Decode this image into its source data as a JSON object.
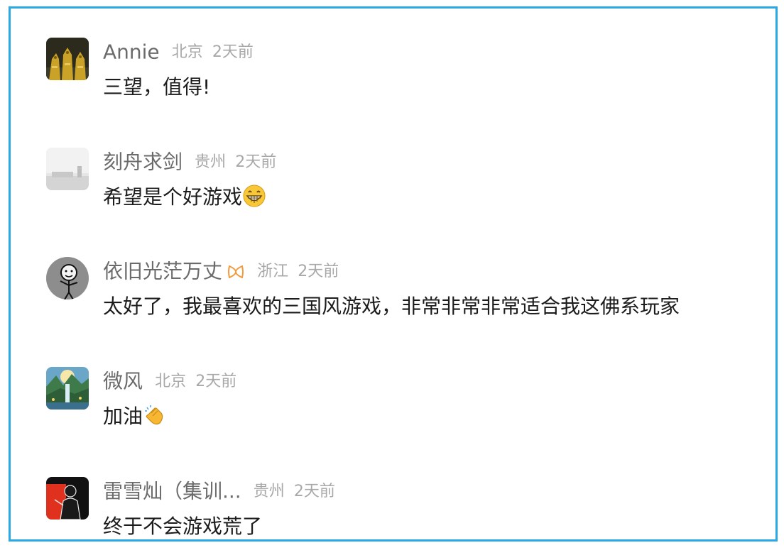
{
  "comments": [
    {
      "name": "Annie",
      "location": "北京",
      "time": "2天前",
      "text": "三望，值得!",
      "avatar": "golden-dragons-avatar"
    },
    {
      "name": "刻舟求剑",
      "location": "贵州",
      "time": "2天前",
      "text": "希望是个好游戏",
      "avatar": "gray-room-avatar",
      "emoji": "grinning-face-emoji"
    },
    {
      "name": "依旧光茫万丈",
      "location": "浙江",
      "time": "2天前",
      "text": "太好了，我最喜欢的三国风游戏，非常非常非常适合我这佛系玩家",
      "avatar": "stick-figure-avatar",
      "badge": "orange-ribbon-badge-icon"
    },
    {
      "name": "微风",
      "location": "北京",
      "time": "2天前",
      "text": "加油",
      "avatar": "waterfall-landscape-avatar",
      "emoji": "clapping-hands-emoji"
    },
    {
      "name": "雷雪灿（集训...",
      "location": "贵州",
      "time": "2天前",
      "text": "终于不会游戏荒了",
      "avatar": "red-silhouette-avatar"
    }
  ],
  "colors": {
    "frame_border": "#2aa9e6",
    "nickname": "#6b6b6b",
    "meta": "#a8a8a8",
    "text": "#1c1c1c",
    "badge": "#f39a3e"
  }
}
